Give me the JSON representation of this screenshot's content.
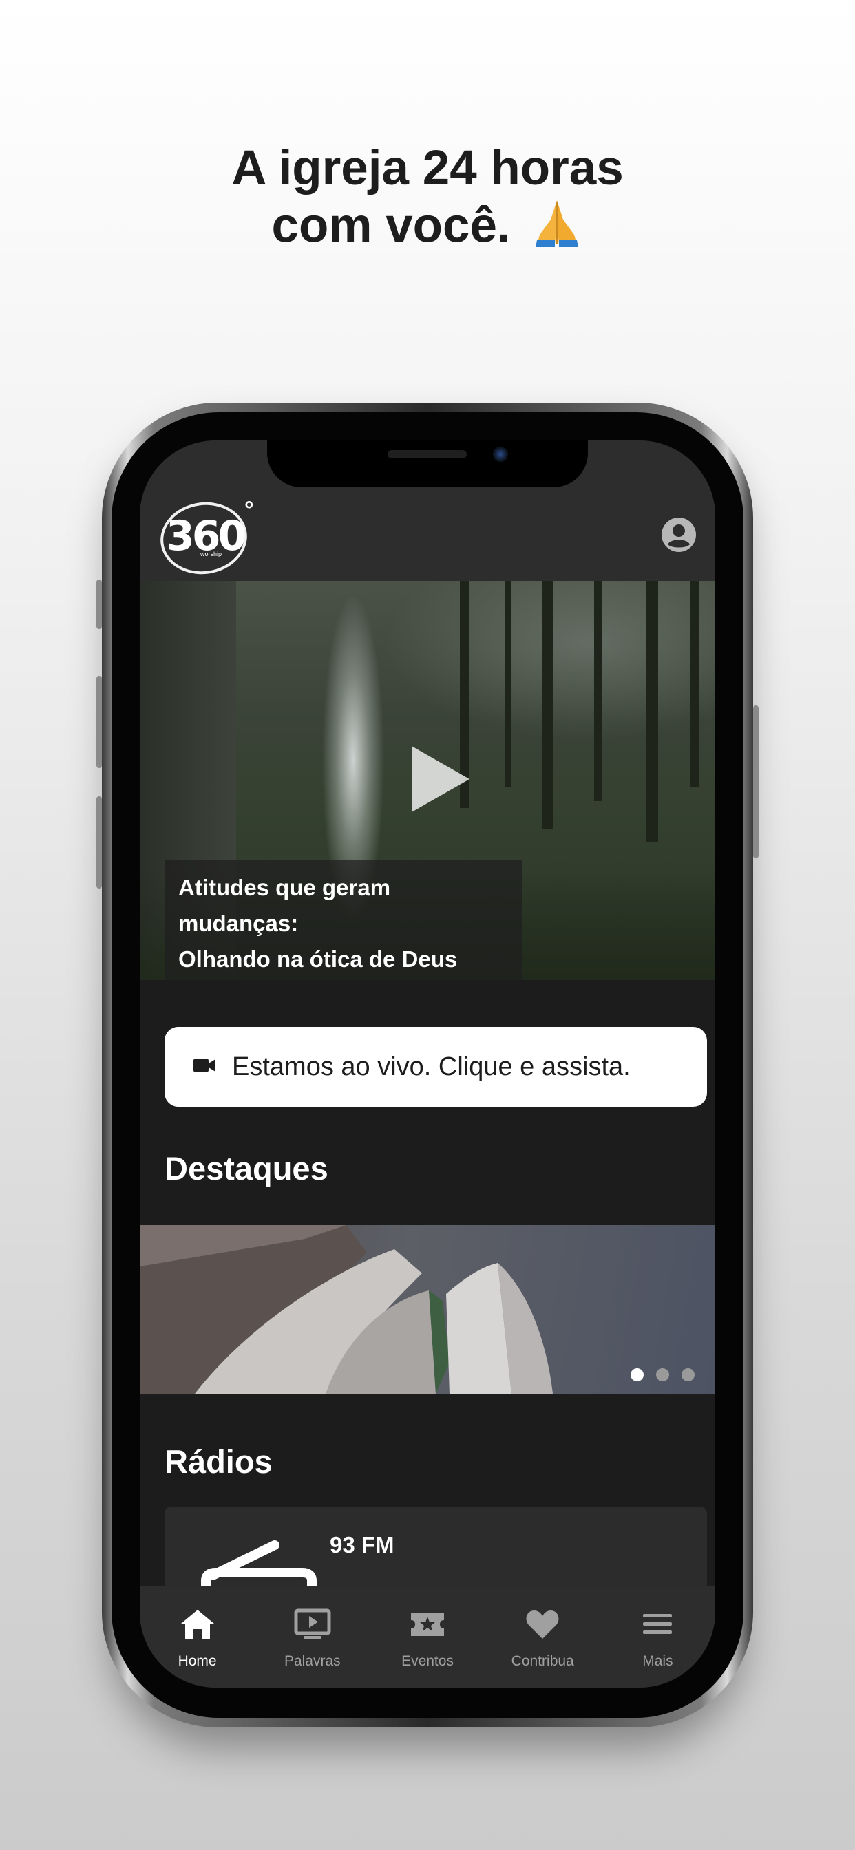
{
  "headline": {
    "line1": "A igreja 24 horas",
    "line2": "com você."
  },
  "header": {
    "logo": {
      "main": "360",
      "degree": "°",
      "sub": "worship"
    },
    "profile_icon": "account-circle-icon"
  },
  "hero": {
    "caption_line1": "Atitudes que geram mudanças:",
    "caption_line2": "Olhando na ótica de Deus",
    "play_icon": "play-icon"
  },
  "live": {
    "icon": "video-camera-icon",
    "label": "Estamos ao vivo. Clique e assista."
  },
  "highlights": {
    "title": "Destaques",
    "slides_count": 3,
    "active_index": 0
  },
  "radios": {
    "title": "Rádios",
    "items": [
      {
        "name": "93 FM"
      }
    ]
  },
  "tabbar": {
    "items": [
      {
        "label": "Home",
        "icon": "home-icon",
        "active": true
      },
      {
        "label": "Palavras",
        "icon": "tv-play-icon",
        "active": false
      },
      {
        "label": "Eventos",
        "icon": "ticket-star-icon",
        "active": false
      },
      {
        "label": "Contribua",
        "icon": "heart-icon",
        "active": false
      },
      {
        "label": "Mais",
        "icon": "menu-icon",
        "active": false
      }
    ]
  },
  "colors": {
    "app_background": "#1c1c1c",
    "header_background": "#2d2d2d",
    "tab_active": "#ffffff",
    "tab_inactive": "#a0a0a0"
  }
}
